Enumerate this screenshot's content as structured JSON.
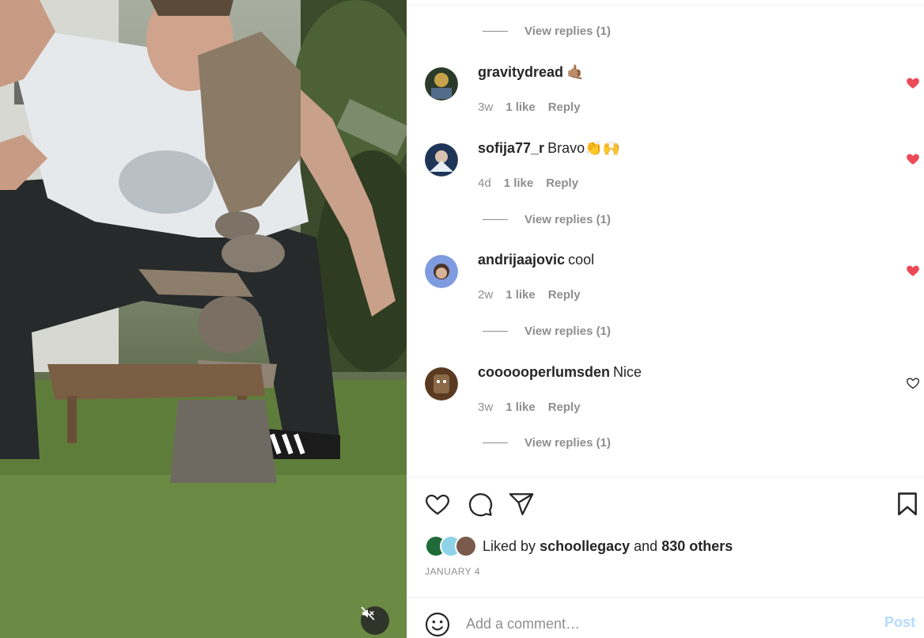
{
  "media": {
    "mute_icon": "speaker-muted-icon"
  },
  "view_replies_label": "View replies (1)",
  "comments": [
    {
      "user": "gravitydread",
      "text": "🤙🏽",
      "age": "3w",
      "likes": "1 like",
      "reply": "Reply",
      "liked": true,
      "avatar_color": "#c8a24a",
      "heart_icon": "heart-filled-icon"
    },
    {
      "user": "sofija77_r",
      "text": "Bravo👏🙌",
      "age": "4d",
      "likes": "1 like",
      "reply": "Reply",
      "liked": true,
      "avatar_color": "#2b4a7a",
      "heart_icon": "heart-filled-icon"
    },
    {
      "user": "andrijaajovic",
      "text": "cool",
      "age": "2w",
      "likes": "1 like",
      "reply": "Reply",
      "liked": true,
      "avatar_color": "#6f8fd8",
      "heart_icon": "heart-filled-icon"
    },
    {
      "user": "coooooperlumsden",
      "text": "Nice",
      "age": "3w",
      "likes": "1 like",
      "reply": "Reply",
      "liked": false,
      "avatar_color": "#6b4a2e",
      "heart_icon": "heart-outline-icon"
    }
  ],
  "actions": {
    "like_icon": "heart-outline-icon",
    "comment_icon": "comment-bubble-icon",
    "share_icon": "paper-plane-icon",
    "save_icon": "bookmark-icon"
  },
  "likes": {
    "prefix": "Liked by",
    "user": "schoollegacy",
    "and": "and",
    "others": "830 others",
    "avatar_colors": [
      "#1f6b3a",
      "#8fd3e8",
      "#7a5a4a"
    ]
  },
  "date": "JANUARY 4",
  "comment_box": {
    "placeholder": "Add a comment…",
    "post_label": "Post",
    "emoji_icon": "smiley-face-icon"
  },
  "colors": {
    "heart_red": "#ed4956",
    "muted_text": "#8e8e8e",
    "post_disabled": "#b3dbff"
  }
}
